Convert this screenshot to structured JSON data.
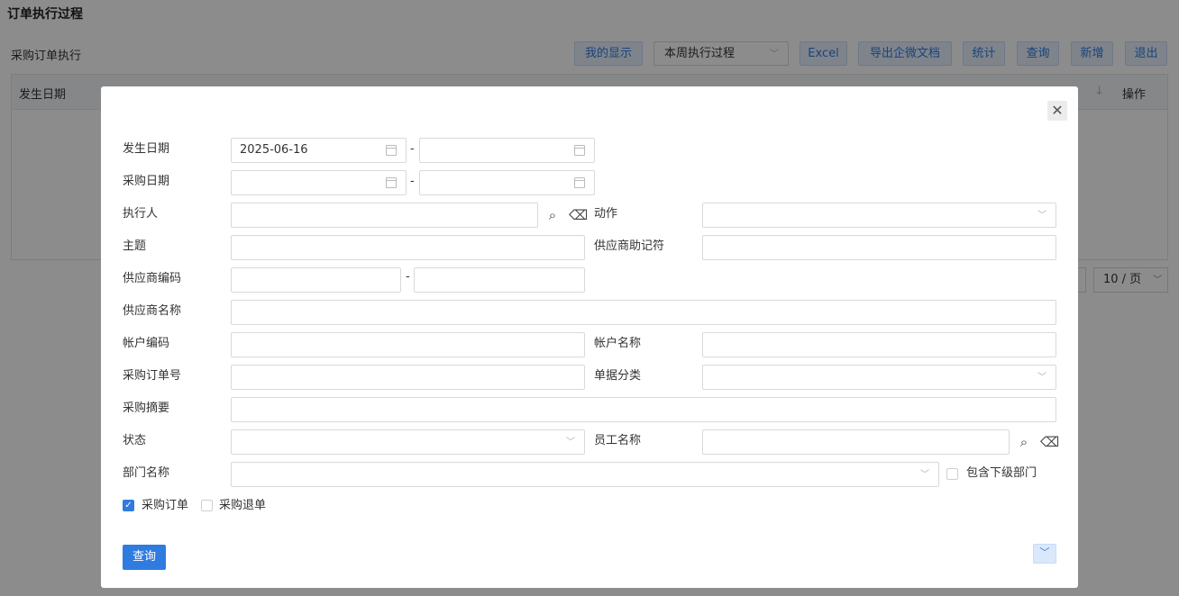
{
  "page_title": "订单执行过程",
  "sub_title": "采购订单执行",
  "toolbar": {
    "my_display": "我的显示",
    "view_select": "本周执行过程",
    "excel": "Excel",
    "export_doc": "导出企微文档",
    "stats": "统计",
    "query": "查询",
    "add": "新增",
    "exit": "退出"
  },
  "grid": {
    "col_date": "发生日期",
    "col_op": "操作",
    "page_size": "10 / 页"
  },
  "form": {
    "occur_date_label": "发生日期",
    "occur_date_from": "2025-06-16",
    "occur_date_to": "",
    "purchase_date_label": "采购日期",
    "executor_label": "执行人",
    "action_label": "动作",
    "subject_label": "主题",
    "supplier_memo_label": "供应商助记符",
    "supplier_code_label": "供应商编码",
    "supplier_name_label": "供应商名称",
    "account_code_label": "帐户编码",
    "account_name_label": "帐户名称",
    "po_number_label": "采购订单号",
    "doc_category_label": "单据分类",
    "purchase_summary_label": "采购摘要",
    "status_label": "状态",
    "employee_name_label": "员工名称",
    "dept_name_label": "部门名称",
    "include_sub_dept": "包含下级部门",
    "purchase_order": "采购订单",
    "purchase_return": "采购退单",
    "dash": "-",
    "query_button": "查询"
  },
  "icons": {
    "close": "close-icon",
    "search": "search-icon",
    "eraser": "eraser-icon",
    "calendar": "calendar-icon"
  },
  "colors": {
    "primary": "#2f7be0"
  }
}
